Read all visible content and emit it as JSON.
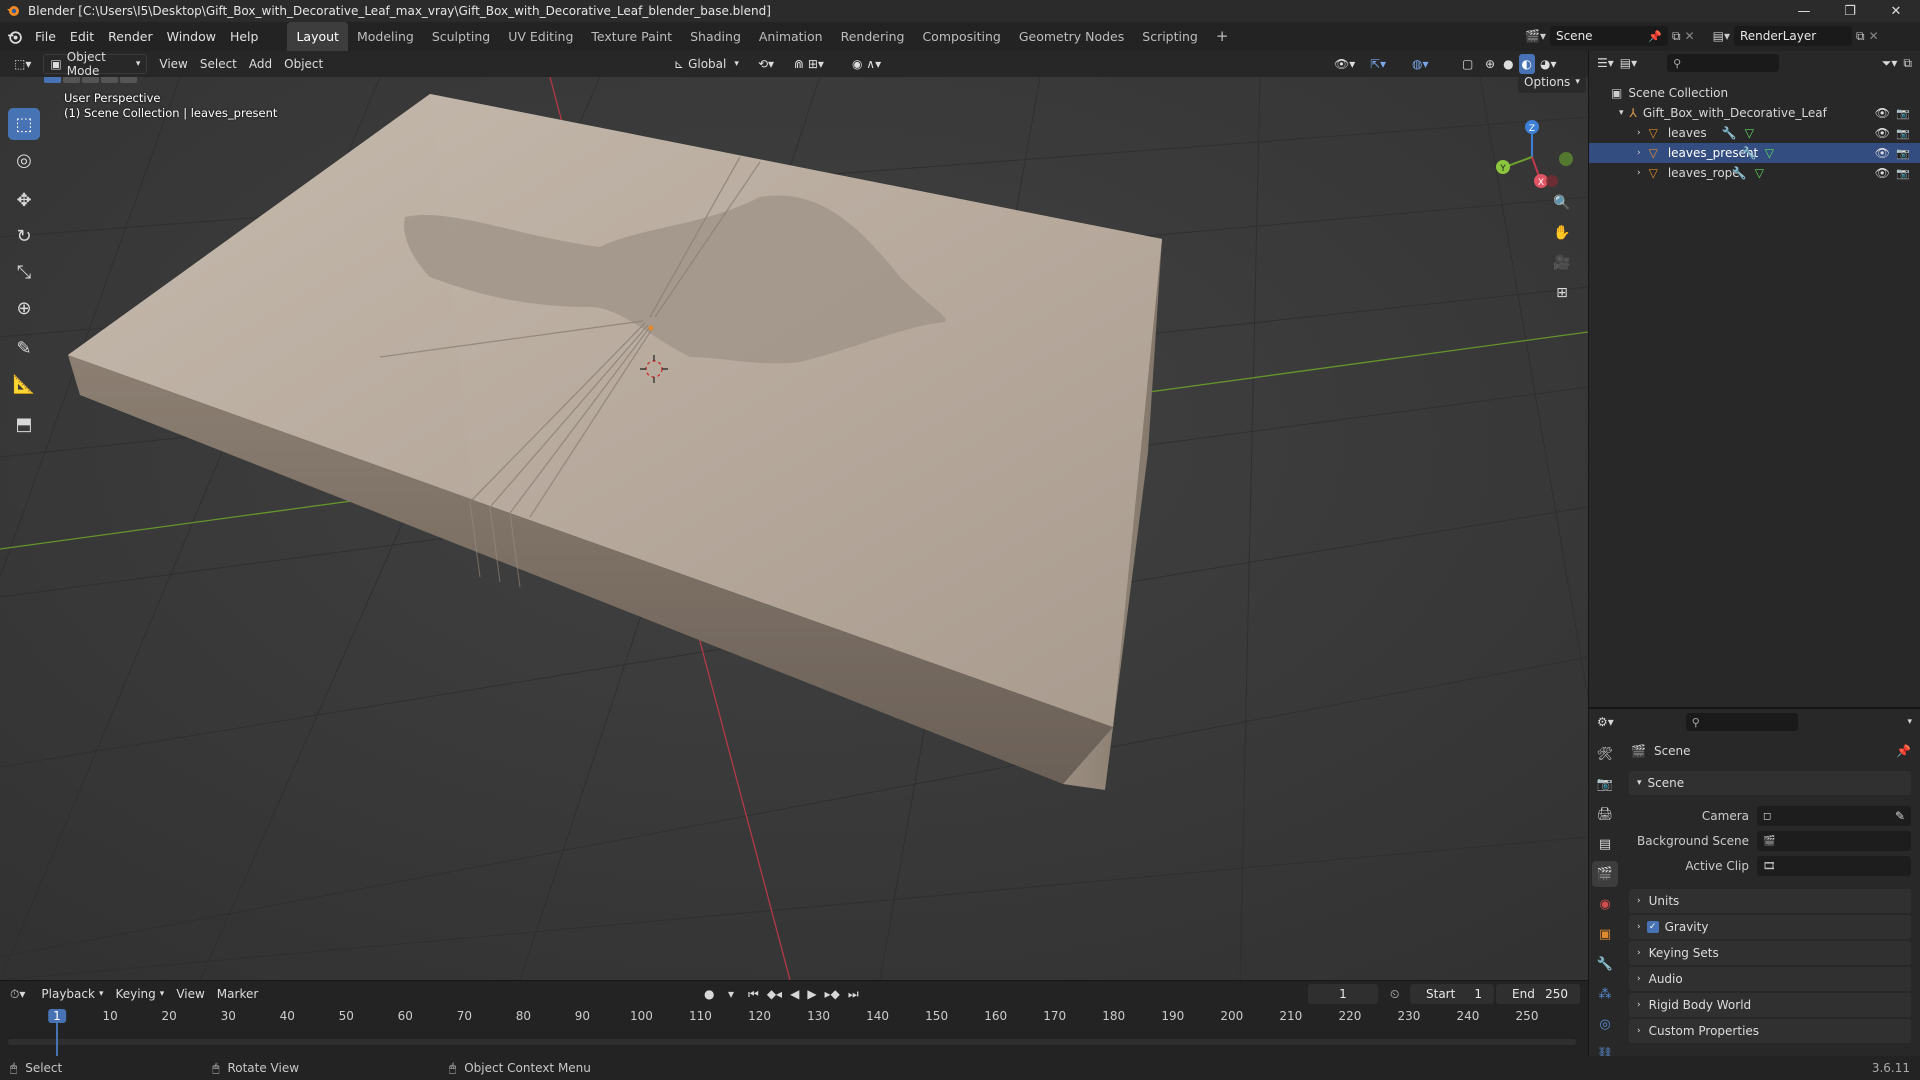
{
  "window": {
    "title": "Blender [C:\\Users\\I5\\Desktop\\Gift_Box_with_Decorative_Leaf_max_vray\\Gift_Box_with_Decorative_Leaf_blender_base.blend]",
    "minimize": "—",
    "maximize": "❐",
    "close": "✕"
  },
  "menubar": {
    "items": [
      "File",
      "Edit",
      "Render",
      "Window",
      "Help"
    ],
    "workspaces": [
      "Layout",
      "Modeling",
      "Sculpting",
      "UV Editing",
      "Texture Paint",
      "Shading",
      "Animation",
      "Rendering",
      "Compositing",
      "Geometry Nodes",
      "Scripting"
    ],
    "active_workspace": "Layout",
    "add_workspace": "+",
    "scene_value": "Scene",
    "viewlayer_value": "RenderLayer"
  },
  "viewport_header": {
    "mode": "Object Mode",
    "menus": [
      "View",
      "Select",
      "Add",
      "Object"
    ],
    "transform_orientation": "Global",
    "options_label": "Options"
  },
  "viewport": {
    "perspective_label": "User Perspective",
    "collection_label": "(1) Scene Collection | leaves_present",
    "axes": {
      "x": "X",
      "y": "Y",
      "z": "Z"
    },
    "colors": {
      "x_axis": "#c0394a",
      "y_axis": "#6b9e2b",
      "z_axis": "#3d7fd6",
      "grid_bg": "#3b3b3b",
      "box": "#b3a79a"
    }
  },
  "outliner": {
    "root": "Scene Collection",
    "collection": "Gift_Box_with_Decorative_Leaf",
    "objects": [
      "leaves",
      "leaves_present",
      "leaves_rope"
    ],
    "search_placeholder": ""
  },
  "properties": {
    "context_title": "Scene",
    "panel_title": "Scene",
    "rows": [
      {
        "label": "Camera",
        "value": ""
      },
      {
        "label": "Background Scene",
        "value": ""
      },
      {
        "label": "Active Clip",
        "value": ""
      }
    ],
    "subpanels": [
      "Units",
      "Gravity",
      "Keying Sets",
      "Audio",
      "Rigid Body World",
      "Custom Properties"
    ],
    "gravity_checked": true
  },
  "timeline": {
    "menus": [
      "Playback",
      "Keying",
      "View",
      "Marker"
    ],
    "current_frame": "1",
    "start_label": "Start",
    "start_value": "1",
    "end_label": "End",
    "end_value": "250",
    "ticks": [
      "1",
      "10",
      "20",
      "30",
      "40",
      "50",
      "60",
      "70",
      "80",
      "90",
      "100",
      "110",
      "120",
      "130",
      "140",
      "150",
      "160",
      "170",
      "180",
      "190",
      "200",
      "210",
      "220",
      "230",
      "240",
      "250"
    ]
  },
  "statusbar": {
    "select": "Select",
    "rotate": "Rotate View",
    "context_menu": "Object Context Menu",
    "version": "3.6.11"
  }
}
